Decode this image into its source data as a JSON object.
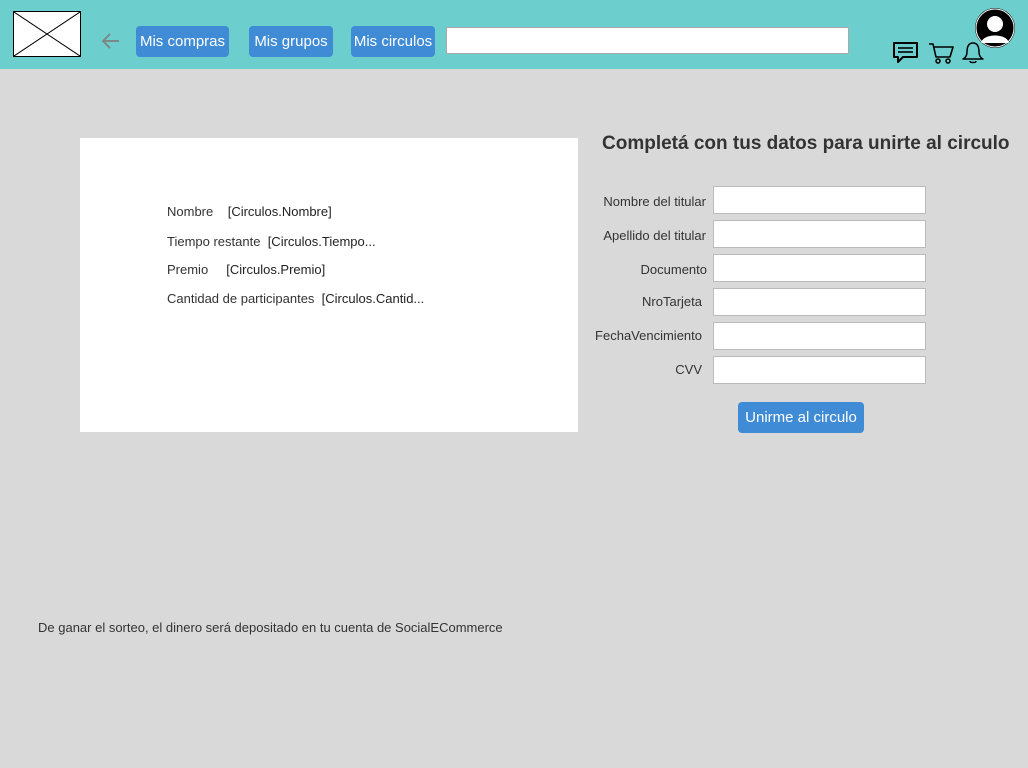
{
  "header": {
    "logo_icon": "image-placeholder-icon",
    "back_icon": "arrow-left-icon",
    "nav": [
      {
        "label": "Mis compras"
      },
      {
        "label": "Mis grupos"
      },
      {
        "label": "Mis circulos"
      }
    ],
    "search": {
      "value": "",
      "placeholder": ""
    },
    "icons": [
      "chat-icon",
      "cart-icon",
      "bell-icon",
      "user-avatar-icon"
    ]
  },
  "circle_info": {
    "rows": [
      {
        "label": "Nombre",
        "value": "[Circulos.Nombre]"
      },
      {
        "label": "Tiempo restante",
        "value": "[Circulos.Tiempo..."
      },
      {
        "label": "Premio",
        "value": "[Circulos.Premio]"
      },
      {
        "label": "Cantidad de participantes",
        "value": "[Circulos.Cantid..."
      }
    ]
  },
  "form": {
    "title": "Completá con tus datos para unirte al circulo",
    "fields": [
      {
        "label": "Nombre del titular",
        "value": ""
      },
      {
        "label": "Apellido del titular",
        "value": ""
      },
      {
        "label": "Documento",
        "value": ""
      },
      {
        "label": "NroTarjeta",
        "value": ""
      },
      {
        "label": "FechaVencimiento",
        "value": ""
      },
      {
        "label": "CVV",
        "value": ""
      }
    ],
    "submit_label": "Unirme al circulo"
  },
  "footer": {
    "note": "De ganar el sorteo, el dinero será depositado en tu cuenta de SocialECommerce"
  },
  "colors": {
    "header_bg": "#6dcfcd",
    "page_bg": "#d9d9d9",
    "button_bg": "#3f8bd5"
  }
}
